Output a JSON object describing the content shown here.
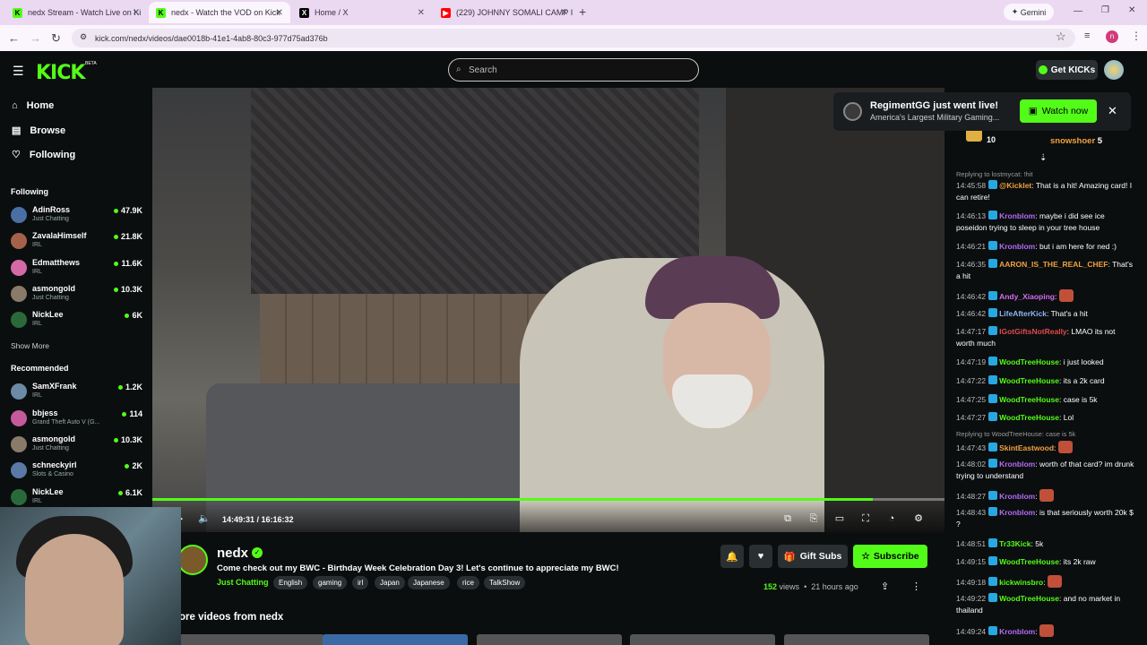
{
  "tabs": [
    {
      "label": "nedx Stream - Watch Live on Ki",
      "icon": "kick-favicon",
      "color": "#53fc18"
    },
    {
      "label": "nedx - Watch the VOD on Kick",
      "icon": "kick-favicon",
      "color": "#53fc18"
    },
    {
      "label": "Home / X",
      "icon": "x-favicon",
      "color": "#000000"
    },
    {
      "label": "(229) JOHNNY SOMALI CAMP I",
      "icon": "youtube-favicon",
      "color": "#ff0000"
    }
  ],
  "gemini_label": "Gemini",
  "url": "kick.com/nedx/videos/dae0018b-41e1-4ab8-80c3-977d75ad376b",
  "header": {
    "search_placeholder": "Search",
    "get_kicks": "Get KICKs",
    "logo": "KICK",
    "beta": "BETA"
  },
  "nav": [
    {
      "label": "Home",
      "icon": "home-icon"
    },
    {
      "label": "Browse",
      "icon": "browse-icon"
    },
    {
      "label": "Following",
      "icon": "heart-icon"
    }
  ],
  "following_header": "Following",
  "following": [
    {
      "name": "AdinRoss",
      "category": "Just Chatting",
      "viewers": "47.9K"
    },
    {
      "name": "ZavalaHimself",
      "category": "IRL",
      "viewers": "21.8K"
    },
    {
      "name": "Edmatthews",
      "category": "IRL",
      "viewers": "11.6K"
    },
    {
      "name": "asmongold",
      "category": "Just Chatting",
      "viewers": "10.3K"
    },
    {
      "name": "NickLee",
      "category": "IRL",
      "viewers": "6K"
    }
  ],
  "show_more": "Show More",
  "recommended_header": "Recommended",
  "recommended": [
    {
      "name": "SamXFrank",
      "category": "IRL",
      "viewers": "1.2K"
    },
    {
      "name": "bbjess",
      "category": "Grand Theft Auto V (G...",
      "viewers": "114"
    },
    {
      "name": "asmongold",
      "category": "Just Chatting",
      "viewers": "10.3K"
    },
    {
      "name": "schneckyirl",
      "category": "Slots & Casino",
      "viewers": "2K"
    },
    {
      "name": "NickLee",
      "category": "IRL",
      "viewers": "6.1K"
    }
  ],
  "player": {
    "time": "14:49:31 / 16:16:32",
    "progress_fraction": 0.91
  },
  "stream": {
    "channel": "nedx",
    "title": "Come check out my BWC - Birthday Week Celebration Day 3! Let's continue to appreciate my BWC!",
    "category": "Just Chatting",
    "tags": [
      "English",
      "gaming",
      "irl",
      "Japan",
      "Japanese",
      "rice",
      "TalkShow"
    ],
    "views_count": "152",
    "views_label": "views",
    "ago": "21 hours ago",
    "gift_subs": "Gift Subs",
    "subscribe": "Subscribe",
    "more_videos": "ore videos from nedx"
  },
  "notification": {
    "title": "RegimentGG just went live!",
    "subtitle": "America's Largest Military Gaming...",
    "button": "Watch now"
  },
  "gifters": [
    {
      "name": "snowshoer",
      "count": "5"
    },
    {
      "count": "10"
    }
  ],
  "chat": [
    {
      "reply": "Replying to lostmycat: !hit"
    },
    {
      "ts": "14:45:58",
      "user": "@Kicklet",
      "color": "#f0a040",
      "text": "That is a hit! Amazing card! I can retire!"
    },
    {
      "ts": "14:46:13",
      "user": "Kronblom",
      "color": "#b36bf5",
      "text": "maybe i did see ice poseidon trying to sleep in your tree house"
    },
    {
      "ts": "14:46:21",
      "user": "Kronblom",
      "color": "#b36bf5",
      "text": "but i am here for ned :)"
    },
    {
      "ts": "14:46:35",
      "user": "AARON_IS_THE_REAL_CHEF",
      "color": "#f0a040",
      "text": "That's a hit"
    },
    {
      "ts": "14:46:42",
      "user": "Andy_Xiaoping",
      "color": "#d46cf2",
      "text": ""
    },
    {
      "ts": "14:46:42",
      "user": "LifeAfterKick",
      "color": "#8fb4f5",
      "text": "That's a hit"
    },
    {
      "ts": "14:47:17",
      "user": "IGotGiftsNotReally",
      "color": "#e24a4a",
      "text": "LMAO its not worth much"
    },
    {
      "ts": "14:47:19",
      "user": "WoodTreeHouse",
      "color": "#53fc18",
      "text": "i just looked"
    },
    {
      "ts": "14:47:22",
      "user": "WoodTreeHouse",
      "color": "#53fc18",
      "text": "its a 2k card"
    },
    {
      "ts": "14:47:25",
      "user": "WoodTreeHouse",
      "color": "#53fc18",
      "text": "case is 5k"
    },
    {
      "ts": "14:47:27",
      "user": "WoodTreeHouse",
      "color": "#53fc18",
      "text": "Lol"
    },
    {
      "reply": "Replying to WoodTreeHouse: case is 5k"
    },
    {
      "ts": "14:47:43",
      "user": "SkintEastwood",
      "color": "#f0a040",
      "text": ""
    },
    {
      "ts": "14:48:02",
      "user": "Kronblom",
      "color": "#b36bf5",
      "text": "worth of that card? im drunk trying to understand"
    },
    {
      "ts": "14:48:27",
      "user": "Kronblom",
      "color": "#b36bf5",
      "text": ""
    },
    {
      "ts": "14:48:43",
      "user": "Kronblom",
      "color": "#b36bf5",
      "text": "is that seriously worth 20k $ ?"
    },
    {
      "ts": "14:48:51",
      "user": "Tr33Kick",
      "color": "#53fc18",
      "text": "5k"
    },
    {
      "ts": "14:49:15",
      "user": "WoodTreeHouse",
      "color": "#53fc18",
      "text": "its 2k raw"
    },
    {
      "ts": "14:49:18",
      "user": "kickwinsbro",
      "color": "#53fc18",
      "text": ""
    },
    {
      "ts": "14:49:22",
      "user": "WoodTreeHouse",
      "color": "#53fc18",
      "text": "and no market in thailand"
    },
    {
      "ts": "14:49:24",
      "user": "Kronblom",
      "color": "#b36bf5",
      "text": ""
    }
  ]
}
